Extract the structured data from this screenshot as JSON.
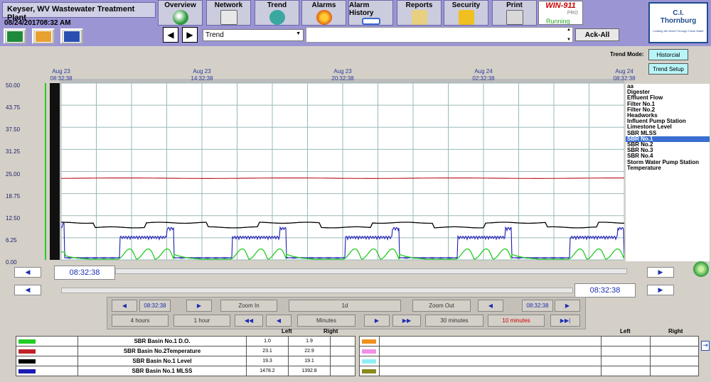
{
  "header": {
    "plant_title": "Keyser, WV Wastewater Treatment Plant",
    "date": "08/24/2017",
    "time": "08:32 AM",
    "nav": [
      {
        "label": "Overview",
        "icon": "globe-icon"
      },
      {
        "label": "Network",
        "icon": "network-icon"
      },
      {
        "label": "Trend",
        "icon": "trend-icon"
      },
      {
        "label": "Alarms",
        "icon": "bell-icon"
      },
      {
        "label": "Alarm History",
        "icon": "calendar-clock-icon"
      },
      {
        "label": "Reports",
        "icon": "folder-icon"
      },
      {
        "label": "Security",
        "icon": "padlock-icon"
      },
      {
        "label": "Print",
        "icon": "printer-icon"
      }
    ],
    "win911": {
      "logo": "WIN-911",
      "edition": "PRO",
      "status": "Running"
    },
    "trend_select": "Trend",
    "ack_all": "Ack-All",
    "company": {
      "name1": "C.I.",
      "name2": "Thornburg",
      "tagline": "Leading the World Through Clean Water"
    },
    "trend_mode_label": "Trend Mode:",
    "mode_historical": "Historcial",
    "trend_setup": "Trend Setup"
  },
  "chart_data": {
    "type": "line",
    "y_ticks": [
      "50.00",
      "43.75",
      "37.50",
      "31.25",
      "25.00",
      "18.75",
      "12.50",
      "6.25",
      "0.00"
    ],
    "ylim": [
      0,
      50
    ],
    "x_ticks": [
      {
        "date": "Aug 23",
        "time": "08:32:38"
      },
      {
        "date": "Aug 23",
        "time": "14:32:38"
      },
      {
        "date": "Aug 23",
        "time": "20:32:38"
      },
      {
        "date": "Aug 24",
        "time": "02:32:38"
      },
      {
        "date": "Aug 24",
        "time": "08:32:38"
      }
    ],
    "grid": true,
    "series": [
      {
        "name": "SBR Basin No.2Temperature",
        "color": "#c0222a",
        "level": 23.1
      },
      {
        "name": "SBR Basin No.1 Level",
        "color": "#000000",
        "level": 19.3
      },
      {
        "name": "SBR Basin No.1 MLSS",
        "color": "#1c1cb4",
        "cycles": 5
      },
      {
        "name": "SBR Basin No.1 D.O.",
        "color": "#22cc22",
        "cycles": 5
      }
    ]
  },
  "tag_list": [
    "aa",
    "Digester",
    "Effluent Flow",
    "Filter No.1",
    "Filter No.2",
    "Headworks",
    "Influent Pump Station",
    "Limestone Level",
    "SBR MLSS",
    "SBR No.1",
    "SBR No.2",
    "SBR No.3",
    "SBR No.4",
    "Storm Water Pump Station",
    "Temperature"
  ],
  "tag_selected": "SBR No.1",
  "scroll": {
    "left_time": "08:32:38",
    "right_time": "08:32:38"
  },
  "controls": {
    "start_time": "08:32:38",
    "zoom_in": "Zoom In",
    "span": "1d",
    "zoom_out": "Zoom Out",
    "end_time": "08:32:38",
    "hours4": "4 hours",
    "hour1": "1 hour",
    "minutes": "Minutes",
    "min30": "30 minutes",
    "min10": "10 minutes"
  },
  "legend": {
    "left_header": "Left",
    "right_header": "Right",
    "rows": [
      {
        "color": "#22cc22",
        "name": "SBR Basin No.1 D.O.",
        "left": "1.0",
        "right": "1.9"
      },
      {
        "color": "#c0222a",
        "name": "SBR Basin No.2Temperature",
        "left": "23.1",
        "right": "22.9"
      },
      {
        "color": "#000000",
        "name": "SBR Basin No.1 Level",
        "left": "19.3",
        "right": "19.1"
      },
      {
        "color": "#1c1cb4",
        "name": "SBR Basin No.1 MLSS",
        "left": "1478.2",
        "right": "1392.8"
      }
    ],
    "rows2": [
      {
        "color": "#f0901e"
      },
      {
        "color": "#f090e8"
      },
      {
        "color": "#90eef8"
      },
      {
        "color": "#8a8a1e"
      }
    ]
  }
}
